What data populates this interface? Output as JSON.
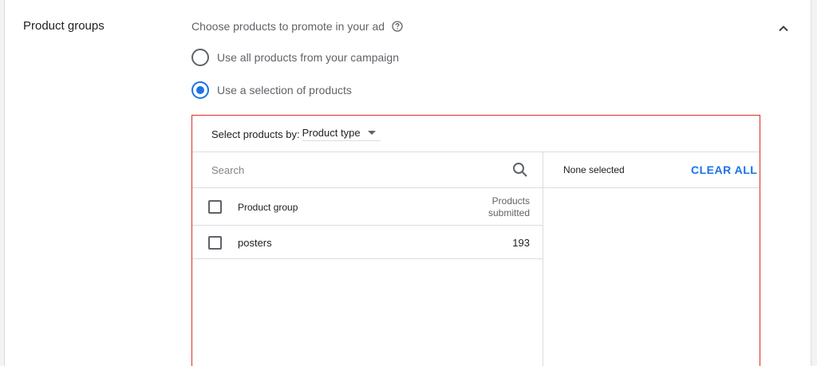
{
  "section": {
    "title": "Product groups",
    "prompt": "Choose products to promote in your ad"
  },
  "options": [
    {
      "label": "Use all products from your campaign",
      "checked": false
    },
    {
      "label": "Use a selection of products",
      "checked": true
    }
  ],
  "picker": {
    "select_by_label": "Select products by:",
    "select_by_value": "Product type",
    "search_placeholder": "Search",
    "none_selected": "None selected",
    "clear_all": "CLEAR ALL",
    "columns": {
      "group": "Product group",
      "submitted_line1": "Products",
      "submitted_line2": "submitted"
    },
    "rows": [
      {
        "name": "posters",
        "count": "193"
      }
    ]
  },
  "colors": {
    "accent": "#1a73e8",
    "error_border": "#d93025"
  },
  "icons": [
    "help-icon",
    "chevron-up-icon",
    "search-icon"
  ]
}
